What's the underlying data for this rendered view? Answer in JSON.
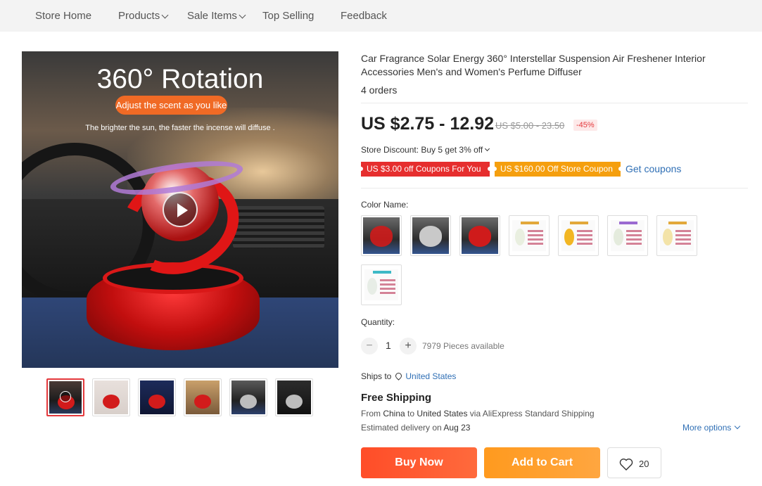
{
  "nav": {
    "items": [
      {
        "label": "Store Home"
      },
      {
        "label": "Products"
      },
      {
        "label": "Sale Items"
      },
      {
        "label": "Top Selling"
      },
      {
        "label": "Feedback"
      }
    ]
  },
  "gallery": {
    "main_title": "360° Rotation",
    "main_pill": "Adjust the scent as you like",
    "main_sub": "The brighter the sun, the faster the incense will diffuse .",
    "thumbnails": 6
  },
  "product": {
    "title": "Car Fragrance Solar Energy 360° Interstellar Suspension Air Freshener Interior Accessories Men's and Women's Perfume Diffuser",
    "orders": "4 orders",
    "price": "US $2.75 - 12.92",
    "old_price": "US $5.00 - 23.50",
    "discount_pct": "-45%",
    "store_discount": "Store Discount: Buy 5 get 3% off",
    "coupon_1": "US $3.00 off Coupons For You",
    "coupon_2": "US $160.00 Off Store Coupon",
    "get_coupons": "Get coupons",
    "color_label": "Color Name:",
    "qty_label": "Quantity:",
    "qty_value": "1",
    "qty_minus": "−",
    "qty_plus": "+",
    "available": "7979 Pieces available"
  },
  "shipping": {
    "ships_to_label": "Ships to",
    "country": "United States",
    "free": "Free Shipping",
    "from_prefix": "From",
    "from_country": "China",
    "to_word": "to",
    "to_country": "United States",
    "via": "via AliExpress Standard Shipping",
    "est_prefix": "Estimated delivery on",
    "est_date": "Aug 23",
    "more_options": "More options"
  },
  "actions": {
    "buy_now": "Buy Now",
    "add_to_cart": "Add to Cart",
    "wishlist_count": "20"
  },
  "colors": {
    "accent_red": "#e62e2e",
    "accent_orange": "#f59f0e",
    "buy_button": "#ff4d28",
    "cart_button": "#ff9a1e",
    "link": "#2f6fb5"
  }
}
